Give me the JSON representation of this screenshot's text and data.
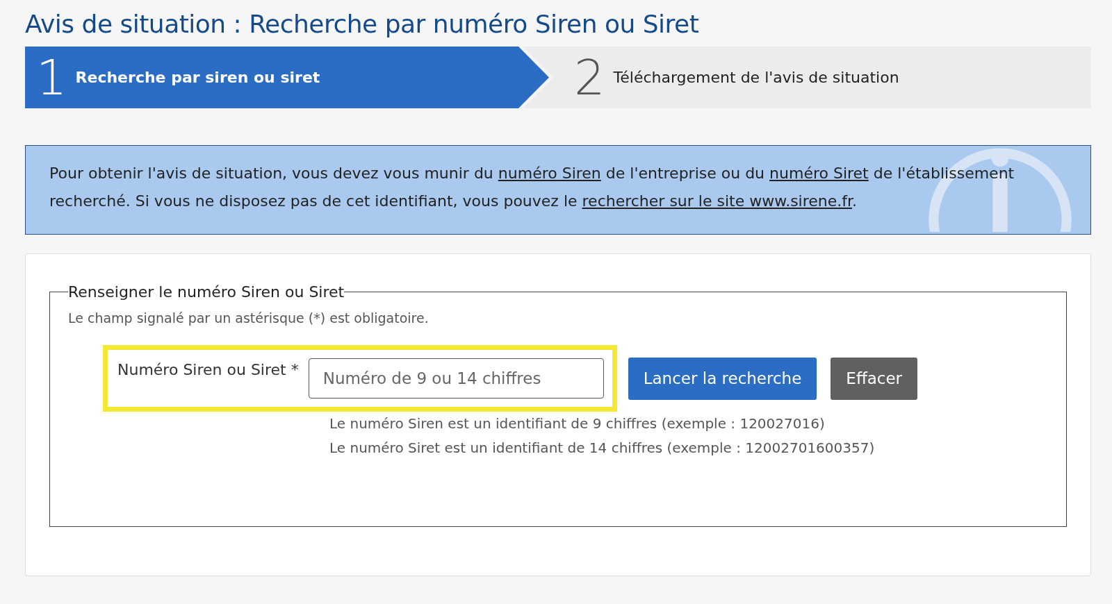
{
  "page_title": "Avis de situation : Recherche par numéro Siren ou Siret",
  "steps": [
    {
      "number": "1",
      "label": "Recherche par siren ou siret",
      "selected": true
    },
    {
      "number": "2",
      "label": "Téléchargement de l'avis de situation",
      "selected": false
    }
  ],
  "info": {
    "parts": [
      {
        "text": "Pour obtenir l'avis de situation, vous devez vous munir du ",
        "link": false
      },
      {
        "text": "numéro Siren",
        "link": true
      },
      {
        "text": " de l'entreprise ou du ",
        "link": false
      },
      {
        "text": "numéro Siret",
        "link": true
      },
      {
        "text": " de l'établissement recherché. Si vous ne disposez pas de cet identifiant, vous pouvez le ",
        "link": false
      },
      {
        "text": "rechercher sur le site www.sirene.fr",
        "link": true
      },
      {
        "text": ".",
        "link": false
      }
    ]
  },
  "form": {
    "legend": "Renseigner le numéro Siren ou Siret",
    "required_note": "Le champ signalé par un astérisque (*) est obligatoire.",
    "field": {
      "label": "Numéro Siren ou Siret *",
      "placeholder": "Numéro de 9 ou 14 chiffres",
      "highlighted": true
    },
    "buttons": [
      {
        "label": "Lancer la recherche",
        "kind": "primary"
      },
      {
        "label": "Effacer",
        "kind": "secondary"
      }
    ],
    "help": [
      "Le numéro Siren est un identifiant de 9 chiffres (exemple : 120027016)",
      "Le numéro Siret est un identifiant de 14 chiffres (exemple : 12002701600357)"
    ]
  }
}
